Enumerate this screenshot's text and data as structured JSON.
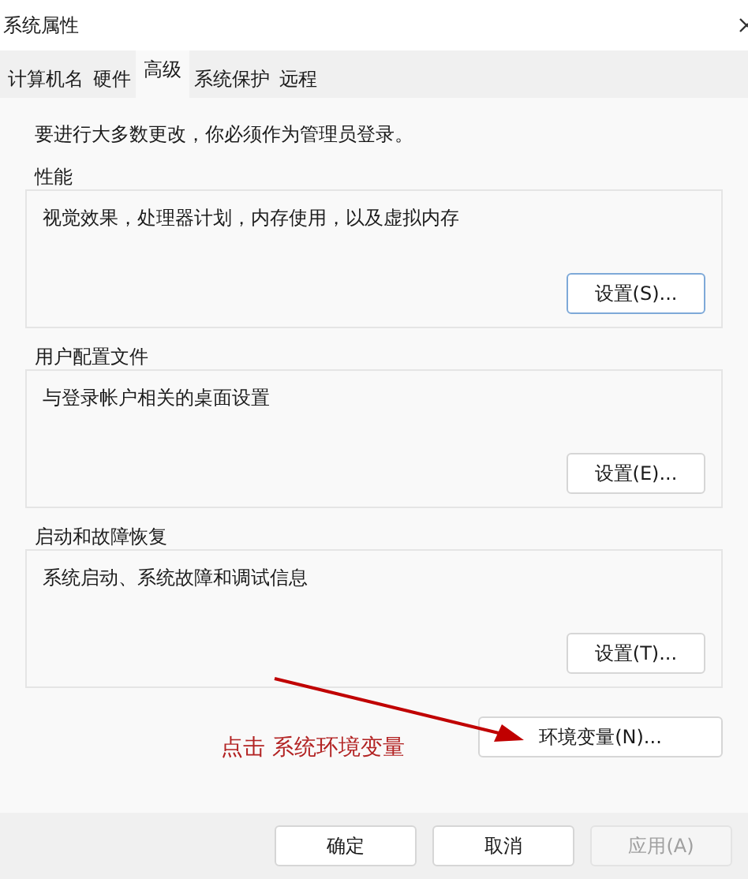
{
  "window": {
    "title": "系统属性"
  },
  "tabs": [
    {
      "label": "计算机名",
      "selected": false
    },
    {
      "label": "硬件",
      "selected": false
    },
    {
      "label": "高级",
      "selected": true
    },
    {
      "label": "系统保护",
      "selected": false
    },
    {
      "label": "远程",
      "selected": false
    }
  ],
  "notice": "要进行大多数更改，你必须作为管理员登录。",
  "groups": [
    {
      "title": "性能",
      "description": "视觉效果，处理器计划，内存使用，以及虚拟内存",
      "button": {
        "label": "设置(S)...",
        "focused": true
      }
    },
    {
      "title": "用户配置文件",
      "description": "与登录帐户相关的桌面设置",
      "button": {
        "label": "设置(E)...",
        "focused": false
      }
    },
    {
      "title": "启动和故障恢复",
      "description": "系统启动、系统故障和调试信息",
      "button": {
        "label": "设置(T)...",
        "focused": false
      }
    }
  ],
  "env_button": {
    "label": "环境变量(N)..."
  },
  "annotation": {
    "text": "点击 系统环境变量"
  },
  "footer_buttons": [
    {
      "label": "确定",
      "disabled": false
    },
    {
      "label": "取消",
      "disabled": false
    },
    {
      "label": "应用(A)",
      "disabled": true
    }
  ]
}
